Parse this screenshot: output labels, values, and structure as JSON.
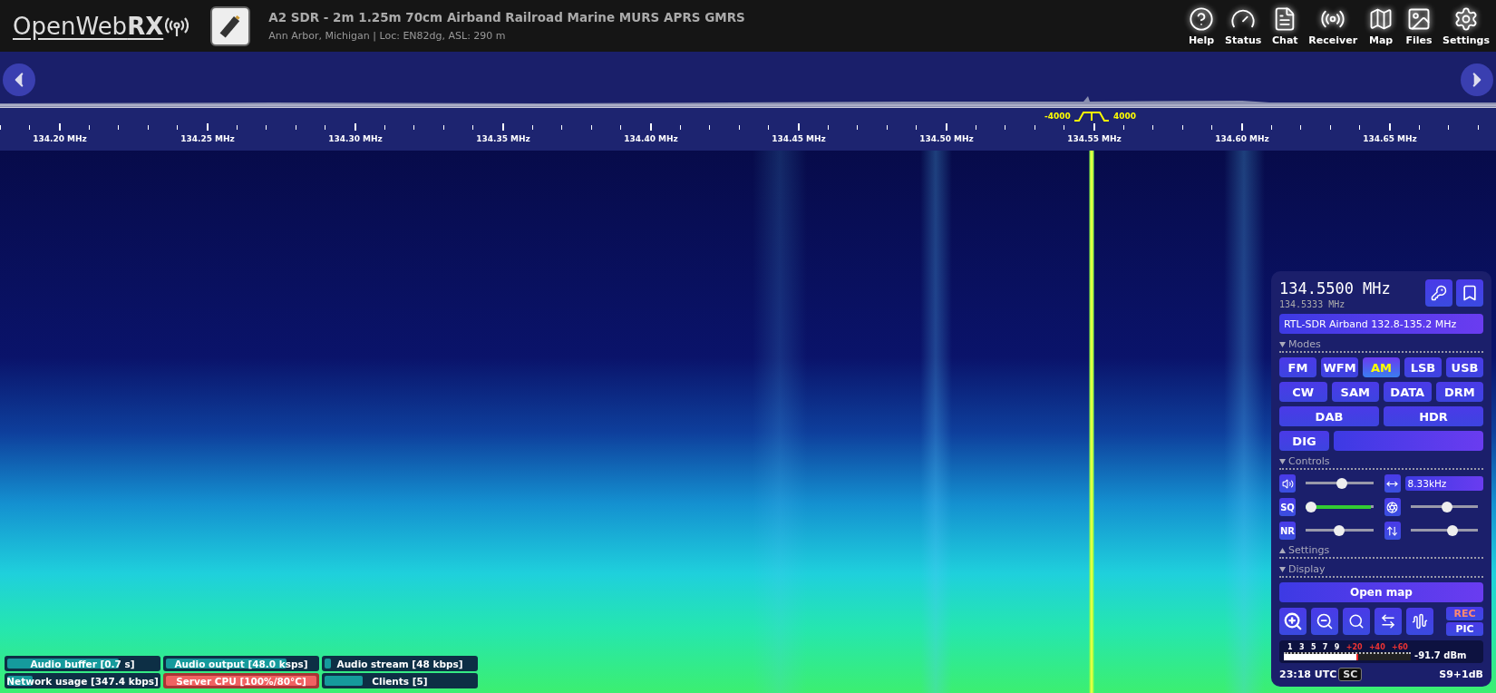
{
  "header": {
    "logo": "OpenWeb**RX**",
    "title": "A2 SDR - 2m 1.25m 70cm Airband Railroad Marine MURS APRS GMRS",
    "subtitle": "Ann Arbor, Michigan | Loc: EN82dg, ASL: 290 m",
    "nav": [
      {
        "kind": "help",
        "label": "Help"
      },
      {
        "kind": "status",
        "label": "Status"
      },
      {
        "kind": "chat",
        "label": "Chat"
      },
      {
        "kind": "receiver",
        "label": "Receiver"
      },
      {
        "kind": "map",
        "label": "Map"
      },
      {
        "kind": "files",
        "label": "Files"
      },
      {
        "kind": "settings",
        "label": "Settings"
      }
    ]
  },
  "scale": {
    "labels": [
      "134.20 MHz",
      "134.25 MHz",
      "134.30 MHz",
      "134.35 MHz",
      "134.40 MHz",
      "134.45 MHz",
      "134.50 MHz",
      "134.55 MHz",
      "134.60 MHz",
      "134.65 MHz"
    ],
    "filter_low": "-4000",
    "filter_high": "4000"
  },
  "panel": {
    "frequency": "134.5500 MHz",
    "offset_frequency": "134.5333 MHz",
    "profile": "RTL-SDR Airband 132.8-135.2 MHz",
    "sections": [
      {
        "label": "Modes",
        "expanded": true
      },
      {
        "label": "Controls",
        "expanded": true
      },
      {
        "label": "Settings",
        "expanded": false
      },
      {
        "label": "Display",
        "expanded": true
      }
    ],
    "modes": [
      [
        {
          "kind": "button",
          "label": "FM",
          "selected": false
        },
        {
          "kind": "button",
          "label": "WFM",
          "selected": false
        },
        {
          "kind": "button",
          "label": "AM",
          "selected": true
        },
        {
          "kind": "button",
          "label": "LSB",
          "selected": false
        },
        {
          "kind": "button",
          "label": "USB",
          "selected": false
        }
      ],
      [
        {
          "kind": "button",
          "label": "CW",
          "selected": false
        },
        {
          "kind": "button",
          "label": "SAM",
          "selected": false
        },
        {
          "kind": "button",
          "label": "DATA",
          "selected": false
        },
        {
          "kind": "button",
          "label": "DRM",
          "selected": false
        }
      ],
      [
        {
          "kind": "button",
          "label": "DAB",
          "selected": false
        },
        {
          "kind": "button",
          "label": "HDR",
          "selected": false
        }
      ],
      [
        {
          "kind": "button",
          "label": "DIG",
          "selected": false
        },
        {
          "kind": "select"
        }
      ]
    ],
    "controls": {
      "volume": {
        "level": 0.55
      },
      "bandwidth": {
        "value": "8.33kHz"
      },
      "squelch": {
        "label": "SQ",
        "level": 0,
        "meter": {
          "level": 0.97
        }
      },
      "agc": {
        "level": 0.55
      },
      "noise_reduction": {
        "label": "NR",
        "level": 0.5
      },
      "gain": {
        "level": 0.65
      }
    },
    "open_map": "Open map",
    "rec": "REC",
    "pic": "PIC",
    "smeter": {
      "labels": [
        {
          "text": "1",
          "kind": "s"
        },
        {
          "text": "3",
          "kind": "s"
        },
        {
          "text": "5",
          "kind": "s"
        },
        {
          "text": "7",
          "kind": "s"
        },
        {
          "text": "9",
          "kind": "s"
        },
        {
          "text": "+20",
          "kind": "db"
        },
        {
          "text": "+40",
          "kind": "db"
        },
        {
          "text": "+60",
          "kind": "db"
        }
      ],
      "level": 0.57,
      "reading": "-91.7 dBm"
    },
    "time": "23:18 UTC",
    "badge": "SC",
    "s_reading": "S9+1dB"
  },
  "status": [
    {
      "label": "Audio buffer [0.7 s]",
      "level": 0.74,
      "alert": false
    },
    {
      "label": "Audio output [48.0 ksps]",
      "level": 0.8,
      "alert": false
    },
    {
      "label": "Audio stream [48 kbps]",
      "level": 0.04,
      "alert": false
    },
    {
      "label": "Network usage [347.4 kbps]",
      "level": 0.17,
      "alert": false
    },
    {
      "label": "Server CPU [100%/80°C]",
      "level": 1,
      "alert": true
    },
    {
      "label": "Clients [5]",
      "level": 0.25,
      "alert": false
    }
  ]
}
